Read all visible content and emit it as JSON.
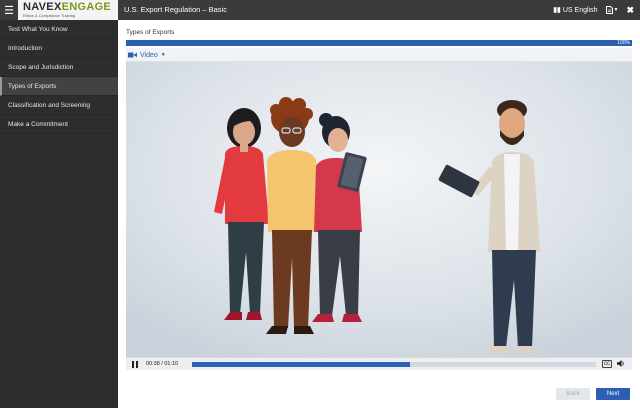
{
  "header": {
    "logo_navex": "NAVEX",
    "logo_engage": "ENGAGE",
    "logo_tagline": "Ethics & Compliance Training",
    "course_title": "U.S. Export Regulation – Basic",
    "language": "US English",
    "icons": {
      "menu": "hamburger-icon",
      "language": "globe-icon",
      "document": "document-icon",
      "close": "close-icon"
    }
  },
  "sidebar": {
    "items": [
      {
        "label": "Test What You Know",
        "active": false
      },
      {
        "label": "Introduction",
        "active": false
      },
      {
        "label": "Scope and Jurisdiction",
        "active": false
      },
      {
        "label": "Types of Exports",
        "active": true
      },
      {
        "label": "Classification and Screening",
        "active": false
      },
      {
        "label": "Make a Commitment",
        "active": false
      }
    ]
  },
  "main": {
    "section_title": "Types of Exports",
    "progress_percent": 100,
    "progress_label": "100%",
    "video_tab_label": "Video",
    "player": {
      "time": "00:38 / 01:10",
      "played_fraction": 0.54
    }
  },
  "footer": {
    "back_label": "Back",
    "next_label": "Next"
  },
  "colors": {
    "accent": "#2c5fb3",
    "topbar": "#3b3b3b",
    "sidebar": "#2d2d2d",
    "engage_green": "#7a9a1a"
  }
}
